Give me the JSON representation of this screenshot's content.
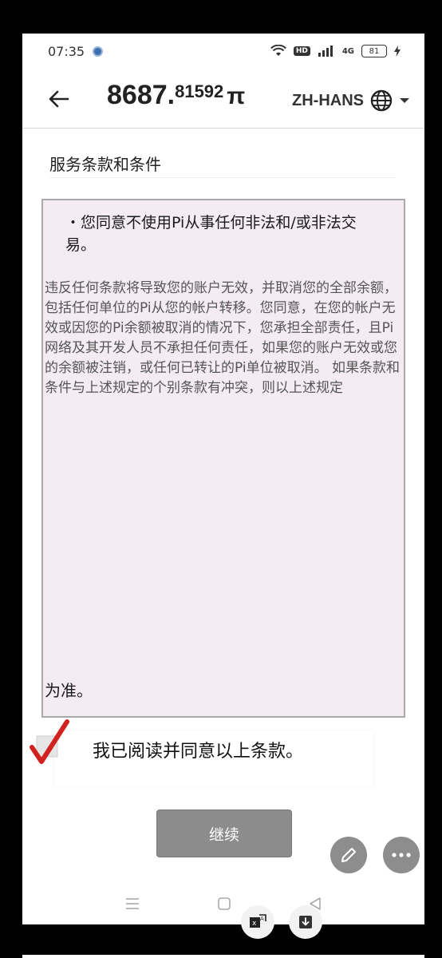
{
  "status_bar": {
    "time": "07:35",
    "hd_badge": "HD",
    "signal_label": "4G",
    "battery": "81"
  },
  "header": {
    "balance_integer": "8687.",
    "balance_fraction": "81592",
    "currency_symbol": "π",
    "language": "ZH-HANS"
  },
  "page": {
    "title": "服务条款和条件",
    "bullet_text": "・您同意不使用Pi从事任何非法和/或非法交易。",
    "body_text": "违反任何条款将导致您的账户无效，并取消您的全部余额，包括任何单位的Pi从您的帐户转移。您同意，在您的帐户无效或因您的Pi余额被取消的情况下，您承担全部责任，且Pi网络及其开发人员不承担任何责任，如果您的账户无效或您的余额被注销，或任何已转让的Pi单位被取消。 如果条款和条件与上述规定的个别条款有冲突，则以上述规定",
    "end_text": "为准。",
    "agree_label": "我已阅读并同意以上条款。",
    "continue_label": "继续"
  },
  "icons": {
    "back": "arrow-left-icon",
    "language": "globe-icon",
    "dropdown": "caret-down-icon",
    "check": "check-mark-icon",
    "edit": "pencil-icon",
    "more": "more-dots-icon",
    "translate": "translate-icon",
    "download": "download-icon"
  },
  "colors": {
    "check_mark": "#d2221f",
    "continue_button": "#8c8c8c",
    "terms_background": "#f4ecf2"
  },
  "state": {
    "agreed": true
  }
}
